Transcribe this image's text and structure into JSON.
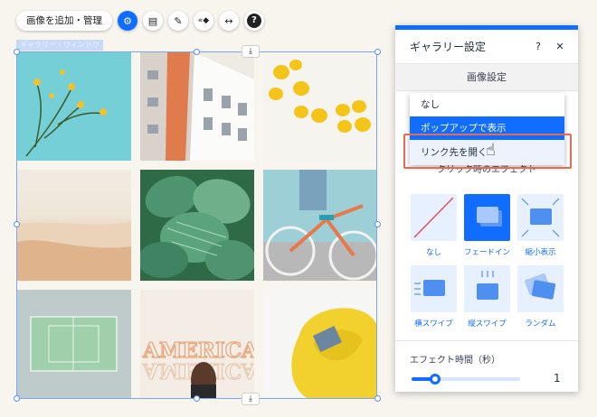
{
  "toolbar": {
    "main_label": "画像を追加・管理",
    "buttons": [
      {
        "icon": "gear-icon",
        "glyph": "⚙"
      },
      {
        "icon": "layout-icon",
        "glyph": "▤"
      },
      {
        "icon": "brush-icon",
        "glyph": "✎"
      },
      {
        "icon": "animation-icon",
        "glyph": "«◆"
      },
      {
        "icon": "stretch-icon",
        "glyph": "↔"
      },
      {
        "icon": "help-icon",
        "glyph": "?"
      }
    ]
  },
  "gallery": {
    "frame_label": "ギャラリー・ウィンドウ",
    "download_glyph": "⤓"
  },
  "panel": {
    "title": "ギャラリー設定",
    "help_glyph": "?",
    "close_glyph": "✕",
    "section": "画像設定",
    "subheading": "クリック時のエフェクト",
    "dropdown": {
      "options": [
        "なし",
        "ポップアップで表示",
        "リンク先を開く"
      ],
      "selected": "ポップアップで表示",
      "hovered": "リンク先を開く"
    },
    "effects": [
      {
        "label": "なし",
        "icon": "none-effect-icon"
      },
      {
        "label": "フェードイン",
        "icon": "fade-in-icon"
      },
      {
        "label": "縮小表示",
        "icon": "shrink-icon"
      },
      {
        "label": "横スワイプ",
        "icon": "swipe-horizontal-icon"
      },
      {
        "label": "縦スワイプ",
        "icon": "swipe-vertical-icon"
      },
      {
        "label": "ランダム",
        "icon": "random-icon"
      }
    ],
    "selected_effect": "フェードイン",
    "duration_label": "エフェクト時間（秒）",
    "duration_value": "1",
    "duration_fraction": 0.22
  },
  "colors": {
    "accent": "#116dff",
    "highlight": "#e86a4f"
  }
}
